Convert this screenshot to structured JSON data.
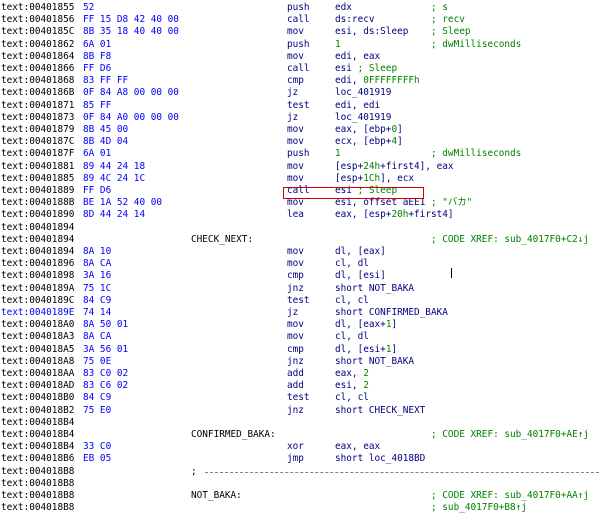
{
  "lines": [
    {
      "addr": "text:00401855",
      "bytes": "52",
      "mnem": "push",
      "ops": [
        {
          "t": "edx"
        }
      ],
      "cmt": [
        {
          "t": "; s"
        }
      ]
    },
    {
      "addr": "text:00401856",
      "bytes": "FF 15 D8 42 40 00",
      "mnem": "call",
      "ops": [
        {
          "t": "ds:recv"
        }
      ],
      "cmt": [
        {
          "t": "; recv"
        }
      ]
    },
    {
      "addr": "text:0040185C",
      "bytes": "8B 35 18 40 40 00",
      "mnem": "mov",
      "ops": [
        {
          "t": "esi, ds:Sleep"
        }
      ],
      "cmt": [
        {
          "t": "; Sleep"
        }
      ]
    },
    {
      "addr": "text:00401862",
      "bytes": "6A 01",
      "mnem": "push",
      "ops": [
        {
          "t": "1",
          "c": "num"
        }
      ],
      "cmt": [
        {
          "t": "; dwMilliseconds"
        }
      ]
    },
    {
      "addr": "text:00401864",
      "bytes": "8B F8",
      "mnem": "mov",
      "ops": [
        {
          "t": "edi, eax"
        }
      ]
    },
    {
      "addr": "text:00401866",
      "bytes": "FF D6",
      "mnem": "call",
      "ops": [
        {
          "t": "esi "
        },
        {
          "t": "; Sleep",
          "c": "num"
        }
      ]
    },
    {
      "addr": "text:00401868",
      "bytes": "83 FF FF",
      "mnem": "cmp",
      "ops": [
        {
          "t": "edi, "
        },
        {
          "t": "0FFFFFFFFh",
          "c": "num"
        }
      ]
    },
    {
      "addr": "text:0040186B",
      "bytes": "0F 84 A8 00 00 00",
      "mnem": "jz",
      "ops": [
        {
          "t": "loc_401919"
        }
      ]
    },
    {
      "addr": "text:00401871",
      "bytes": "85 FF",
      "mnem": "test",
      "ops": [
        {
          "t": "edi, edi"
        }
      ]
    },
    {
      "addr": "text:00401873",
      "bytes": "0F 84 A0 00 00 00",
      "mnem": "jz",
      "ops": [
        {
          "t": "loc_401919"
        }
      ]
    },
    {
      "addr": "text:00401879",
      "bytes": "8B 45 00",
      "mnem": "mov",
      "ops": [
        {
          "t": "eax, [ebp+"
        },
        {
          "t": "0",
          "c": "num"
        },
        {
          "t": "]"
        }
      ]
    },
    {
      "addr": "text:0040187C",
      "bytes": "8B 4D 04",
      "mnem": "mov",
      "ops": [
        {
          "t": "ecx, [ebp+"
        },
        {
          "t": "4",
          "c": "num"
        },
        {
          "t": "]"
        }
      ]
    },
    {
      "addr": "text:0040187F",
      "bytes": "6A 01",
      "mnem": "push",
      "ops": [
        {
          "t": "1",
          "c": "num"
        }
      ],
      "cmt": [
        {
          "t": "; dwMilliseconds"
        }
      ]
    },
    {
      "addr": "text:00401881",
      "bytes": "89 44 24 18",
      "mnem": "mov",
      "ops": [
        {
          "t": "[esp+"
        },
        {
          "t": "24h",
          "c": "num"
        },
        {
          "t": "+first4], eax"
        }
      ]
    },
    {
      "addr": "text:00401885",
      "bytes": "89 4C 24 1C",
      "mnem": "mov",
      "ops": [
        {
          "t": "[esp+"
        },
        {
          "t": "1Ch",
          "c": "num"
        },
        {
          "t": "], ecx"
        }
      ]
    },
    {
      "addr": "text:00401889",
      "bytes": "FF D6",
      "mnem": "call",
      "ops": [
        {
          "t": "esi "
        },
        {
          "t": "; Sleep",
          "c": "num"
        }
      ]
    },
    {
      "addr": "text:0040188B",
      "bytes": "BE 1A 52 40 00",
      "mnem": "mov",
      "ops": [
        {
          "t": "esi, offset aEE1 "
        },
        {
          "t": "; \"バカ\"",
          "c": "str"
        }
      ]
    },
    {
      "addr": "text:00401890",
      "bytes": "8D 44 24 14",
      "mnem": "lea",
      "ops": [
        {
          "t": "eax, [esp+"
        },
        {
          "t": "20h",
          "c": "num"
        },
        {
          "t": "+first4]"
        }
      ]
    },
    {
      "addr": "text:00401894"
    },
    {
      "addr": "text:00401894",
      "label": "CHECK_NEXT:",
      "cmt": [
        {
          "t": "; CODE XREF: sub_4017F0+C2↓j"
        }
      ]
    },
    {
      "addr": "text:00401894",
      "bytes": "8A 10",
      "mnem": "mov",
      "ops": [
        {
          "t": "dl, [eax]"
        }
      ]
    },
    {
      "addr": "text:00401896",
      "bytes": "8A CA",
      "mnem": "mov",
      "ops": [
        {
          "t": "cl, dl"
        }
      ]
    },
    {
      "addr": "text:00401898",
      "bytes": "3A 16",
      "mnem": "cmp",
      "ops": [
        {
          "t": "dl, [esi]"
        }
      ]
    },
    {
      "addr": "text:0040189A",
      "bytes": "75 1C",
      "mnem": "jnz",
      "ops": [
        {
          "t": "short NOT_BAKA"
        }
      ]
    },
    {
      "addr": "text:0040189C",
      "bytes": "84 C9",
      "mnem": "test",
      "ops": [
        {
          "t": "cl, cl"
        }
      ]
    },
    {
      "addr": "text:0040189E",
      "bytes": "74 14",
      "mnem": "jz",
      "ops": [
        {
          "t": "short CONFIRMED_BAKA"
        }
      ],
      "sel": true
    },
    {
      "addr": "text:004018A0",
      "bytes": "8A 50 01",
      "mnem": "mov",
      "ops": [
        {
          "t": "dl, [eax+"
        },
        {
          "t": "1",
          "c": "num"
        },
        {
          "t": "]"
        }
      ]
    },
    {
      "addr": "text:004018A3",
      "bytes": "8A CA",
      "mnem": "mov",
      "ops": [
        {
          "t": "cl, dl"
        }
      ]
    },
    {
      "addr": "text:004018A5",
      "bytes": "3A 56 01",
      "mnem": "cmp",
      "ops": [
        {
          "t": "dl, [esi+"
        },
        {
          "t": "1",
          "c": "num"
        },
        {
          "t": "]"
        }
      ]
    },
    {
      "addr": "text:004018A8",
      "bytes": "75 0E",
      "mnem": "jnz",
      "ops": [
        {
          "t": "short NOT_BAKA"
        }
      ]
    },
    {
      "addr": "text:004018AA",
      "bytes": "83 C0 02",
      "mnem": "add",
      "ops": [
        {
          "t": "eax, "
        },
        {
          "t": "2",
          "c": "num"
        }
      ]
    },
    {
      "addr": "text:004018AD",
      "bytes": "83 C6 02",
      "mnem": "add",
      "ops": [
        {
          "t": "esi, "
        },
        {
          "t": "2",
          "c": "num"
        }
      ]
    },
    {
      "addr": "text:004018B0",
      "bytes": "84 C9",
      "mnem": "test",
      "ops": [
        {
          "t": "cl, cl"
        }
      ]
    },
    {
      "addr": "text:004018B2",
      "bytes": "75 E0",
      "mnem": "jnz",
      "ops": [
        {
          "t": "short CHECK_NEXT"
        }
      ]
    },
    {
      "addr": "text:004018B4"
    },
    {
      "addr": "text:004018B4",
      "label": "CONFIRMED_BAKA:",
      "cmt": [
        {
          "t": "; CODE XREF: sub_4017F0+AE↑j"
        }
      ]
    },
    {
      "addr": "text:004018B4",
      "bytes": "33 C0",
      "mnem": "xor",
      "ops": [
        {
          "t": "eax, eax"
        }
      ]
    },
    {
      "addr": "text:004018B6",
      "bytes": "EB 05",
      "mnem": "jmp",
      "ops": [
        {
          "t": "short loc_4018BD"
        }
      ]
    },
    {
      "addr": "text:004018B8",
      "sep": ";"
    },
    {
      "addr": "text:004018B8"
    },
    {
      "addr": "text:004018B8",
      "label": "NOT_BAKA:",
      "cmt": [
        {
          "t": "; CODE XREF: sub_4017F0+AA↑j"
        }
      ]
    },
    {
      "addr": "text:004018B8",
      "cmt": [
        {
          "t": "; sub_4017F0+B8↑j"
        }
      ]
    }
  ]
}
